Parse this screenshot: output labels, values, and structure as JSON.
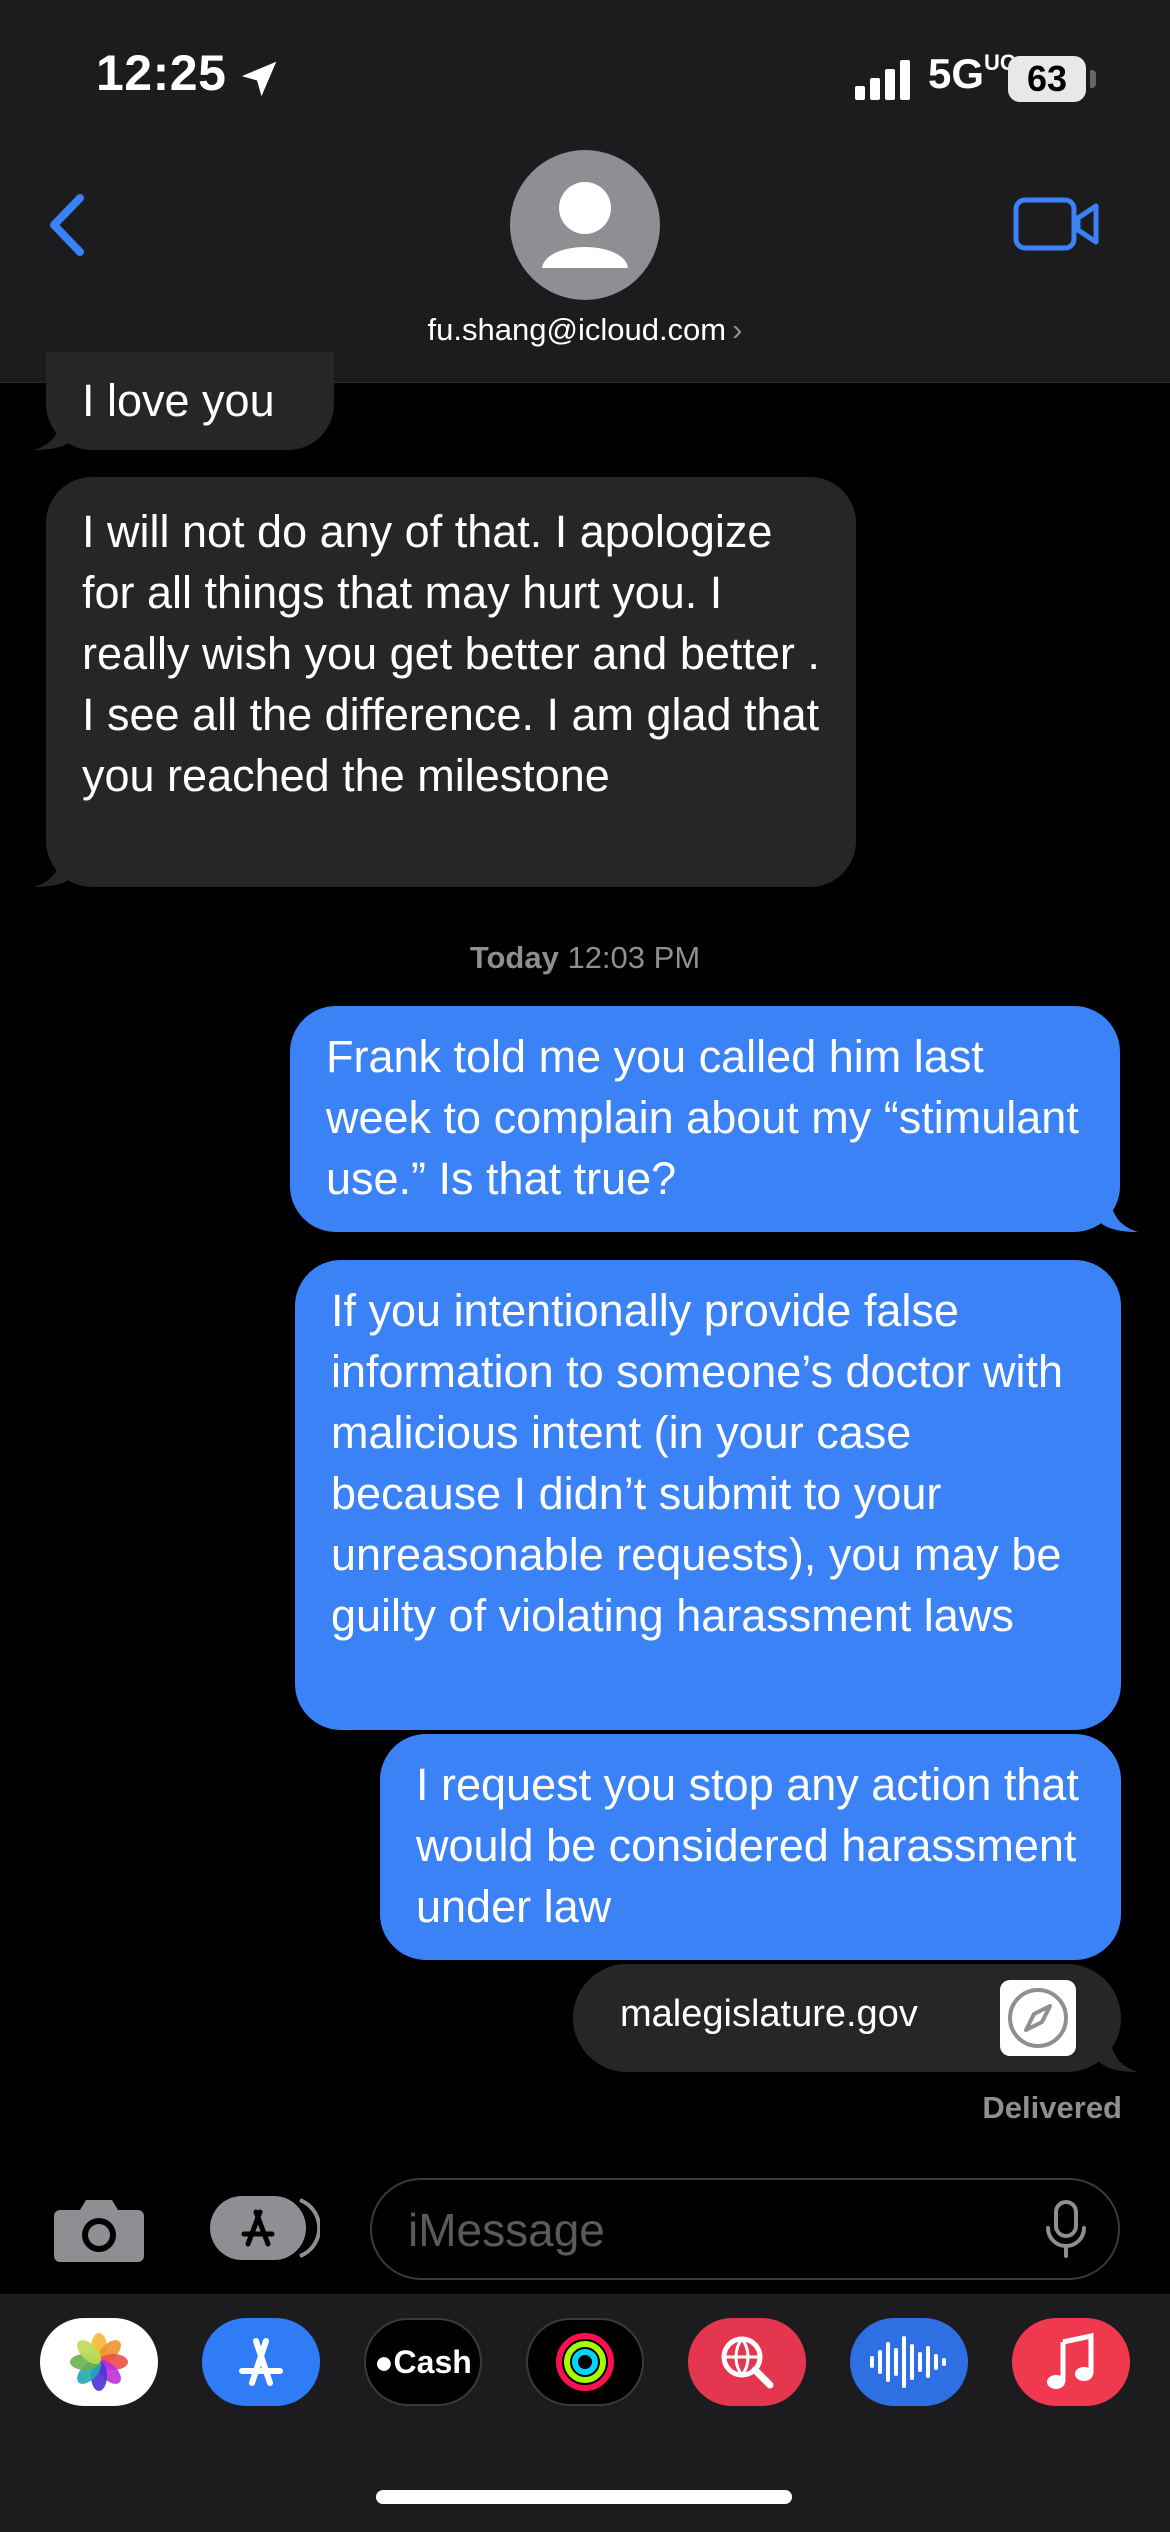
{
  "status_bar": {
    "time": "12:25",
    "network": "5G",
    "network_suffix": "UC",
    "battery": "63"
  },
  "header": {
    "contact": "fu.shang@icloud.com",
    "chevron": "›"
  },
  "messages": {
    "partial_received": "I love you",
    "received_1": "I will not do any of that. I apologize for all things that may hurt you. I really wish you get better and better . I see all the difference. I am glad that you reached the milestone",
    "timestamp_day": "Today",
    "timestamp_time": "12:03 PM",
    "sent_1": "Frank told me you called him last week to complain about my “stimulant use.” Is that true?",
    "sent_2": "If you intentionally provide false information to someone’s doctor with malicious intent (in your case because I didn’t submit to your unreasonable requests), you may be guilty of violating harassment laws",
    "sent_3": "I request you stop any action that would be considered harassment under law",
    "link_domain": "malegislature.gov",
    "status": "Delivered"
  },
  "input": {
    "placeholder": "iMessage"
  },
  "app_drawer": {
    "apps": [
      "photos-icon",
      "app-store-icon",
      "cash-icon",
      "fitness-icon",
      "search-web-icon",
      "voice-memo-icon",
      "music-icon"
    ],
    "cash_label": "Cash"
  },
  "colors": {
    "sent_bubble": "#3a82f6",
    "received_bubble": "#262629",
    "accent": "#3a82f6",
    "background": "#000000"
  }
}
